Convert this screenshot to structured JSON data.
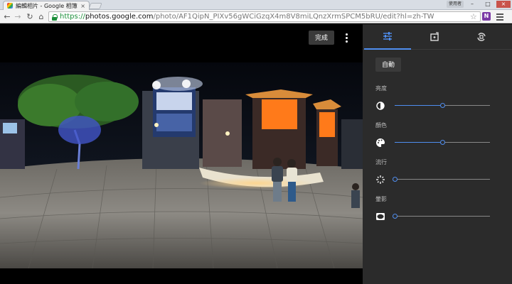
{
  "browser": {
    "tab_title": "編輯相片 - Google 相簿",
    "tab_close": "×",
    "window_user": "使用者",
    "url_scheme": "https://",
    "url_host": "photos.google.com",
    "url_path": "/photo/AF1QipN_PIXv56gWCiGzqX4m8V8miLQnzXrmSPCM5bRU/edit?hl=zh-TW",
    "extension_label": "N"
  },
  "viewer": {
    "done_label": "完成"
  },
  "panel": {
    "tabs": [
      {
        "icon": "tune-icon"
      },
      {
        "icon": "crop-rotate-icon"
      },
      {
        "icon": "rotate-icon"
      }
    ],
    "active_tab": 0,
    "auto_label": "自動",
    "sliders": [
      {
        "label": "亮度",
        "icon": "brightness-icon",
        "value": 0.5
      },
      {
        "label": "顏色",
        "icon": "palette-icon",
        "value": 0.5
      },
      {
        "label": "流行",
        "icon": "pop-icon",
        "value": 0.0
      },
      {
        "label": "暈影",
        "icon": "vignette-icon",
        "value": 0.0
      }
    ]
  },
  "colors": {
    "accent": "#4f8ef0",
    "panel_bg": "#2b2b2b",
    "secure_green": "#1b8f3a"
  }
}
